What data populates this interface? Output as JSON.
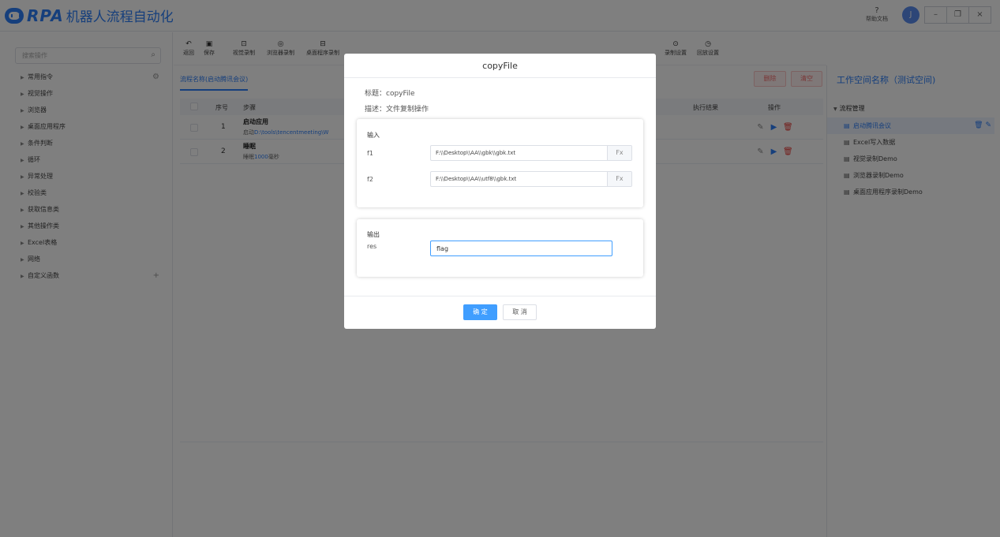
{
  "app": {
    "logo_text": "RPA",
    "title": "机器人流程自动化"
  },
  "header": {
    "help_label": "帮助文档",
    "avatar_initial": "J"
  },
  "sidebar": {
    "search_placeholder": "搜索操作",
    "items": [
      {
        "label": "常用指令"
      },
      {
        "label": "视觉操作"
      },
      {
        "label": "浏览器"
      },
      {
        "label": "桌面应用程序"
      },
      {
        "label": "条件判断"
      },
      {
        "label": "循环"
      },
      {
        "label": "异常处理"
      },
      {
        "label": "校验类"
      },
      {
        "label": "获取信息类"
      },
      {
        "label": "其他操作类"
      },
      {
        "label": "Excel表格"
      },
      {
        "label": "网络"
      },
      {
        "label": "自定义函数"
      }
    ]
  },
  "toolbar": {
    "items": [
      {
        "label": "返回",
        "icon": "undo-icon"
      },
      {
        "label": "保存",
        "icon": "save-icon"
      },
      {
        "label": "视觉录制",
        "icon": "visual-record-icon"
      },
      {
        "label": "浏览器录制",
        "icon": "browser-record-icon"
      },
      {
        "label": "桌面程序录制",
        "icon": "desktop-record-icon"
      },
      {
        "label": "录制设置",
        "icon": "record-settings-icon"
      },
      {
        "label": "回放设置",
        "icon": "playback-settings-icon"
      }
    ]
  },
  "flow": {
    "tab_label": "流程名称(启动腾讯会议)",
    "delete_label": "删除",
    "clear_label": "清空",
    "columns": {
      "index": "序号",
      "step": "步骤",
      "result": "执行结果",
      "action": "操作"
    },
    "rows": [
      {
        "index": "1",
        "title": "启动应用",
        "desc_prefix": "启动",
        "desc_value": "D:\\tools\\tencentmeeting\\W",
        "desc_suffix": ""
      },
      {
        "index": "2",
        "title": "睡眠",
        "desc_prefix": "睡眠",
        "desc_value": "1000",
        "desc_suffix": "毫秒"
      }
    ]
  },
  "workspace": {
    "title": "工作空间名称（测试空间)",
    "group": "流程管理",
    "items": [
      {
        "label": "启动腾讯会议",
        "active": true
      },
      {
        "label": "Excel写入数据",
        "active": false
      },
      {
        "label": "视觉录制Demo",
        "active": false
      },
      {
        "label": "浏览器录制Demo",
        "active": false
      },
      {
        "label": "桌面应用程序录制Demo",
        "active": false
      }
    ]
  },
  "dialog": {
    "title": "copyFile",
    "name_label": "标题：",
    "name_value": "copyFile",
    "desc_label": "描述：",
    "desc_value": "文件复制操作",
    "input_section": "输入",
    "inputs": [
      {
        "name": "f1",
        "value": "F:\\\\Desktop\\\\AA\\\\gbk\\\\gbk.txt",
        "fx": "Fx"
      },
      {
        "name": "f2",
        "value": "F:\\\\Desktop\\\\AA\\\\utf8\\\\gbk.txt",
        "fx": "Fx"
      }
    ],
    "output_section": "输出",
    "output": {
      "name": "res",
      "value": "flag"
    },
    "ok_label": "确 定",
    "cancel_label": "取 消"
  }
}
